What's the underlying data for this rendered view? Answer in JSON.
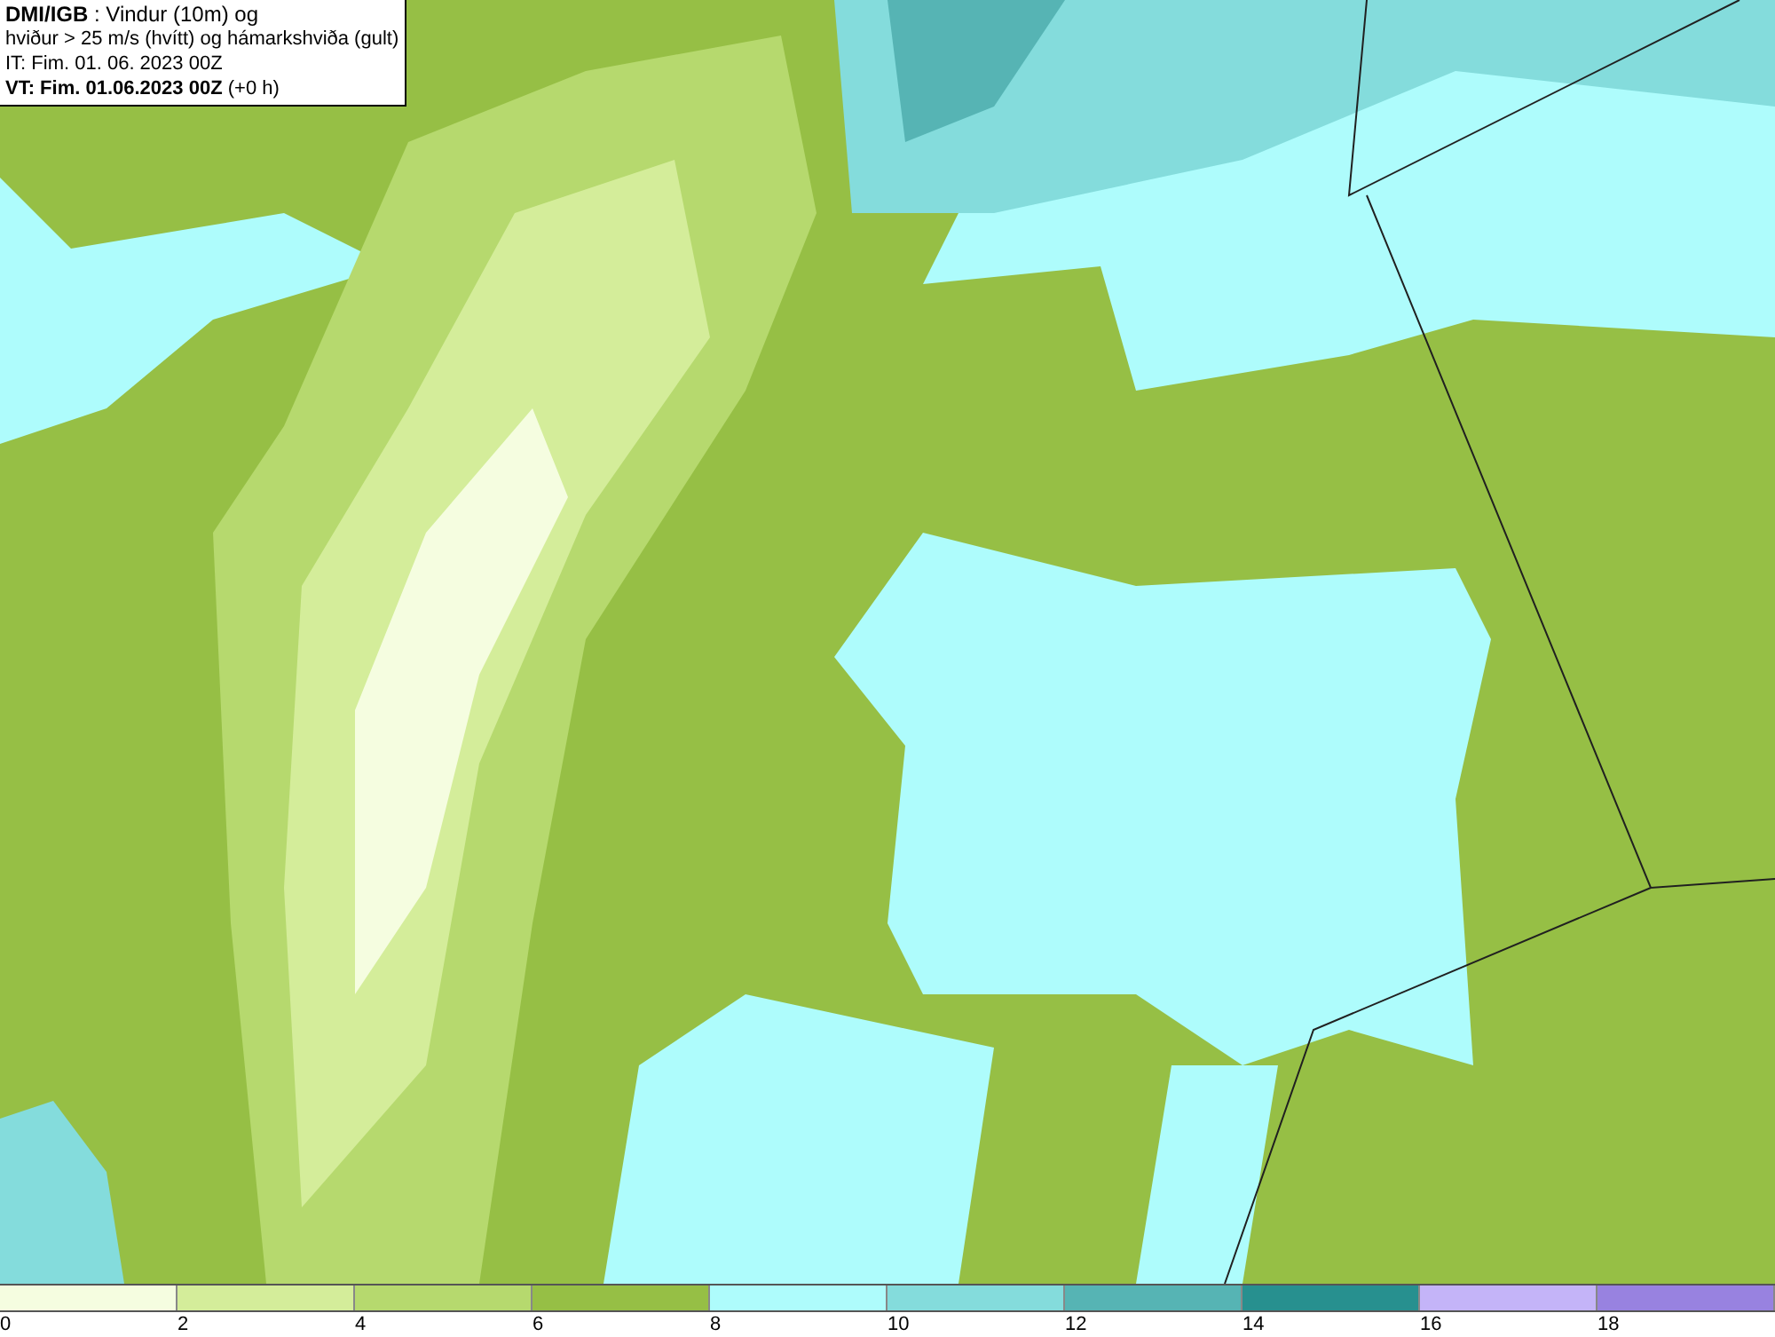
{
  "header": {
    "lines": [
      "**DMI/IGB** : Vindur (10m) og",
      "hviður > 25 m/s (hvítt) og hámarkshviða (gult)",
      "IT: Fim. 01. 06. 2023 00Z",
      "**VT: Fim. 01.06.2023 00Z** (+0 h)"
    ]
  },
  "legend": {
    "swatches": [
      {
        "color": "#f5fde0"
      },
      {
        "color": "#d4ed9a"
      },
      {
        "color": "#b6d96e"
      },
      {
        "color": "#96bf45"
      },
      {
        "color": "#aefcfc"
      },
      {
        "color": "#84dcdc"
      },
      {
        "color": "#56b4b4"
      },
      {
        "color": "#27908f"
      },
      {
        "color": "#c4b4f8"
      },
      {
        "color": "#9882e0"
      }
    ],
    "labels": [
      "0",
      "2",
      "4",
      "6",
      "8",
      "10",
      "12",
      "14",
      "16",
      "18"
    ]
  }
}
